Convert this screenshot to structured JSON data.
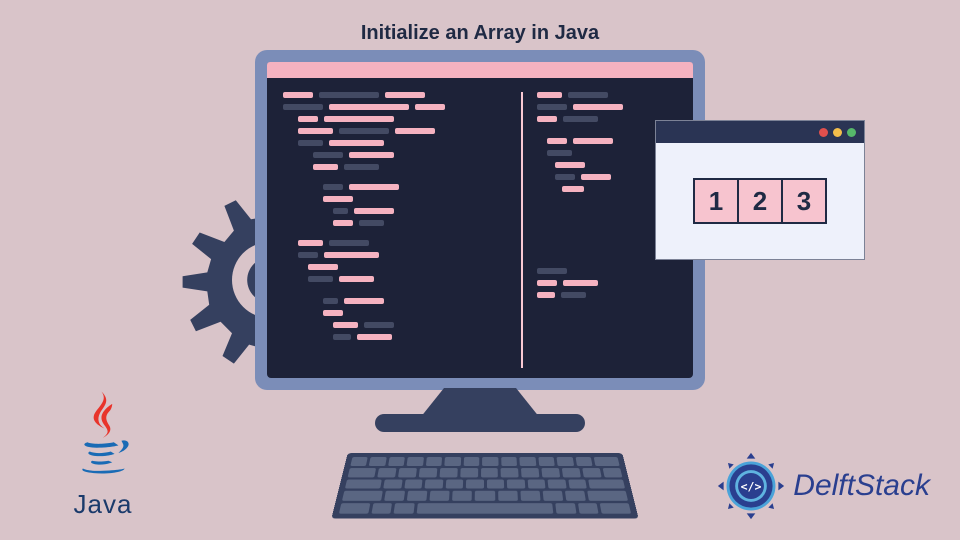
{
  "title": "Initialize an Array in Java",
  "array_cells": {
    "c1": "1",
    "c2": "2",
    "c3": "3"
  },
  "logos": {
    "java_text": "Java",
    "delft_text": "DelftStack"
  },
  "colors": {
    "background": "#d9c4c9",
    "monitor_frame": "#7b8db8",
    "screen": "#1d2238",
    "accent_pink": "#f5b2c0",
    "dark_navy": "#35405f",
    "delft_blue": "#2a3f8f"
  }
}
